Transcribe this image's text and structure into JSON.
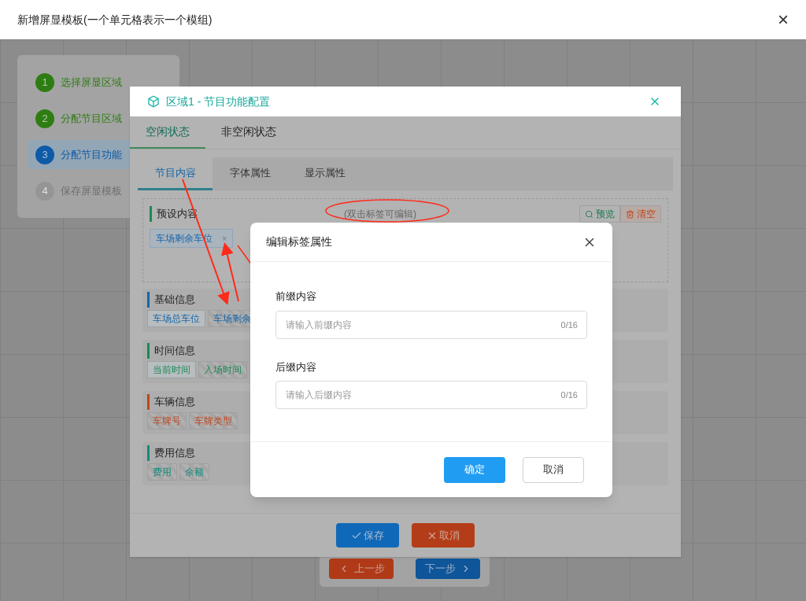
{
  "window": {
    "title": "新增屏显模板(一个单元格表示一个模组)",
    "close": "×"
  },
  "steps": [
    {
      "number": "1",
      "label": "选择屏显区域",
      "done": true,
      "selected": false
    },
    {
      "number": "2",
      "label": "分配节目区域",
      "done": true,
      "selected": false
    },
    {
      "number": "3",
      "label": "分配节目功能",
      "done": false,
      "selected": true
    },
    {
      "number": "4",
      "label": "保存屏显模板",
      "done": false,
      "selected": false
    }
  ],
  "step_nav": {
    "prev": "上一步",
    "next": "下一步"
  },
  "config_dialog": {
    "title": "区域1 - 节目功能配置",
    "state_tabs": [
      {
        "label": "空闲状态",
        "selected": true
      },
      {
        "label": "非空闲状态",
        "selected": false
      }
    ],
    "content_tabs": [
      {
        "label": "节目内容",
        "selected": true
      },
      {
        "label": "字体属性",
        "selected": false
      },
      {
        "label": "显示属性",
        "selected": false
      }
    ],
    "preset": {
      "title": "预设内容",
      "hint": "(双击标签可编辑)",
      "preview": "预览",
      "clear": "清空",
      "tags": [
        {
          "label": "车场剩余车位",
          "remove": "×"
        }
      ]
    },
    "categories": [
      {
        "title": "基础信息",
        "color": "#1565a8",
        "tags": [
          {
            "label": "车场总车位",
            "disabled": false
          },
          {
            "label": "车场剩余",
            "disabled": true
          }
        ]
      },
      {
        "title": "时间信息",
        "color": "#1a8a55",
        "tags": [
          {
            "label": "当前时间",
            "disabled": false
          },
          {
            "label": "入场时间",
            "disabled": true
          }
        ]
      },
      {
        "title": "车辆信息",
        "color": "#c2441b",
        "tags": [
          {
            "label": "车牌号",
            "disabled": true
          },
          {
            "label": "车牌类型",
            "disabled": true
          }
        ]
      },
      {
        "title": "费用信息",
        "color": "#148a7a",
        "tags": [
          {
            "label": "费用",
            "disabled": true
          },
          {
            "label": "余额",
            "disabled": true
          }
        ]
      }
    ],
    "save": "保存",
    "cancel": "取消"
  },
  "edit_dialog": {
    "title": "编辑标签属性",
    "fields": [
      {
        "label": "前缀内容",
        "placeholder": "请输入前缀内容",
        "count": "0/16"
      },
      {
        "label": "后缀内容",
        "placeholder": "请输入后缀内容",
        "count": "0/16"
      }
    ],
    "confirm": "确定",
    "cancel": "取消"
  }
}
